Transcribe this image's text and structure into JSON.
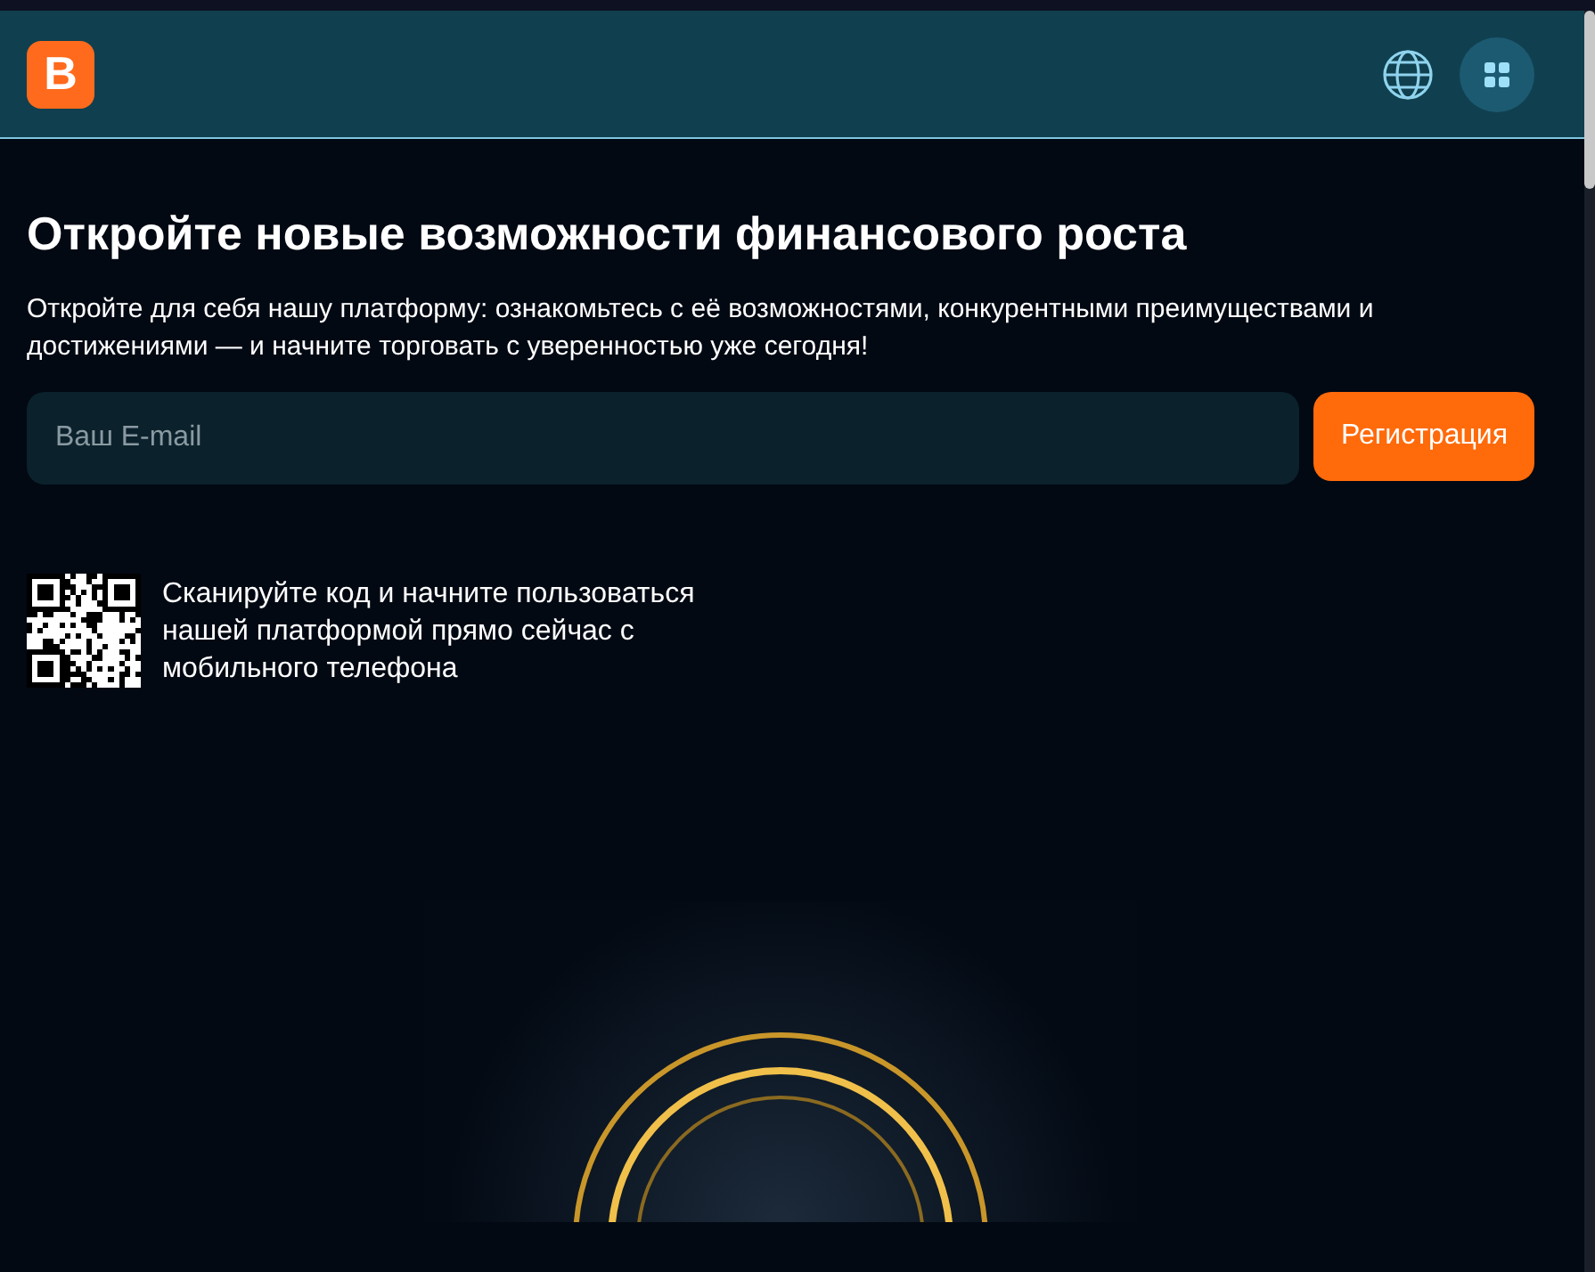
{
  "header": {
    "logo": "B"
  },
  "hero": {
    "title": "Откройте новые возможности финансового роста",
    "subtitle": "Откройте для себя нашу платформу: ознакомьтесь с её возможностями, конкурентными преимуществами и достижениями — и начните торговать с уверенностью уже сегодня!"
  },
  "signup": {
    "email": {
      "placeholder": "Ваш E-mail"
    },
    "button": "Регистрация"
  },
  "qr": {
    "text": "Сканируйте код и начните пользоваться нашей платформой прямо сейчас с мобильного телефона"
  }
}
